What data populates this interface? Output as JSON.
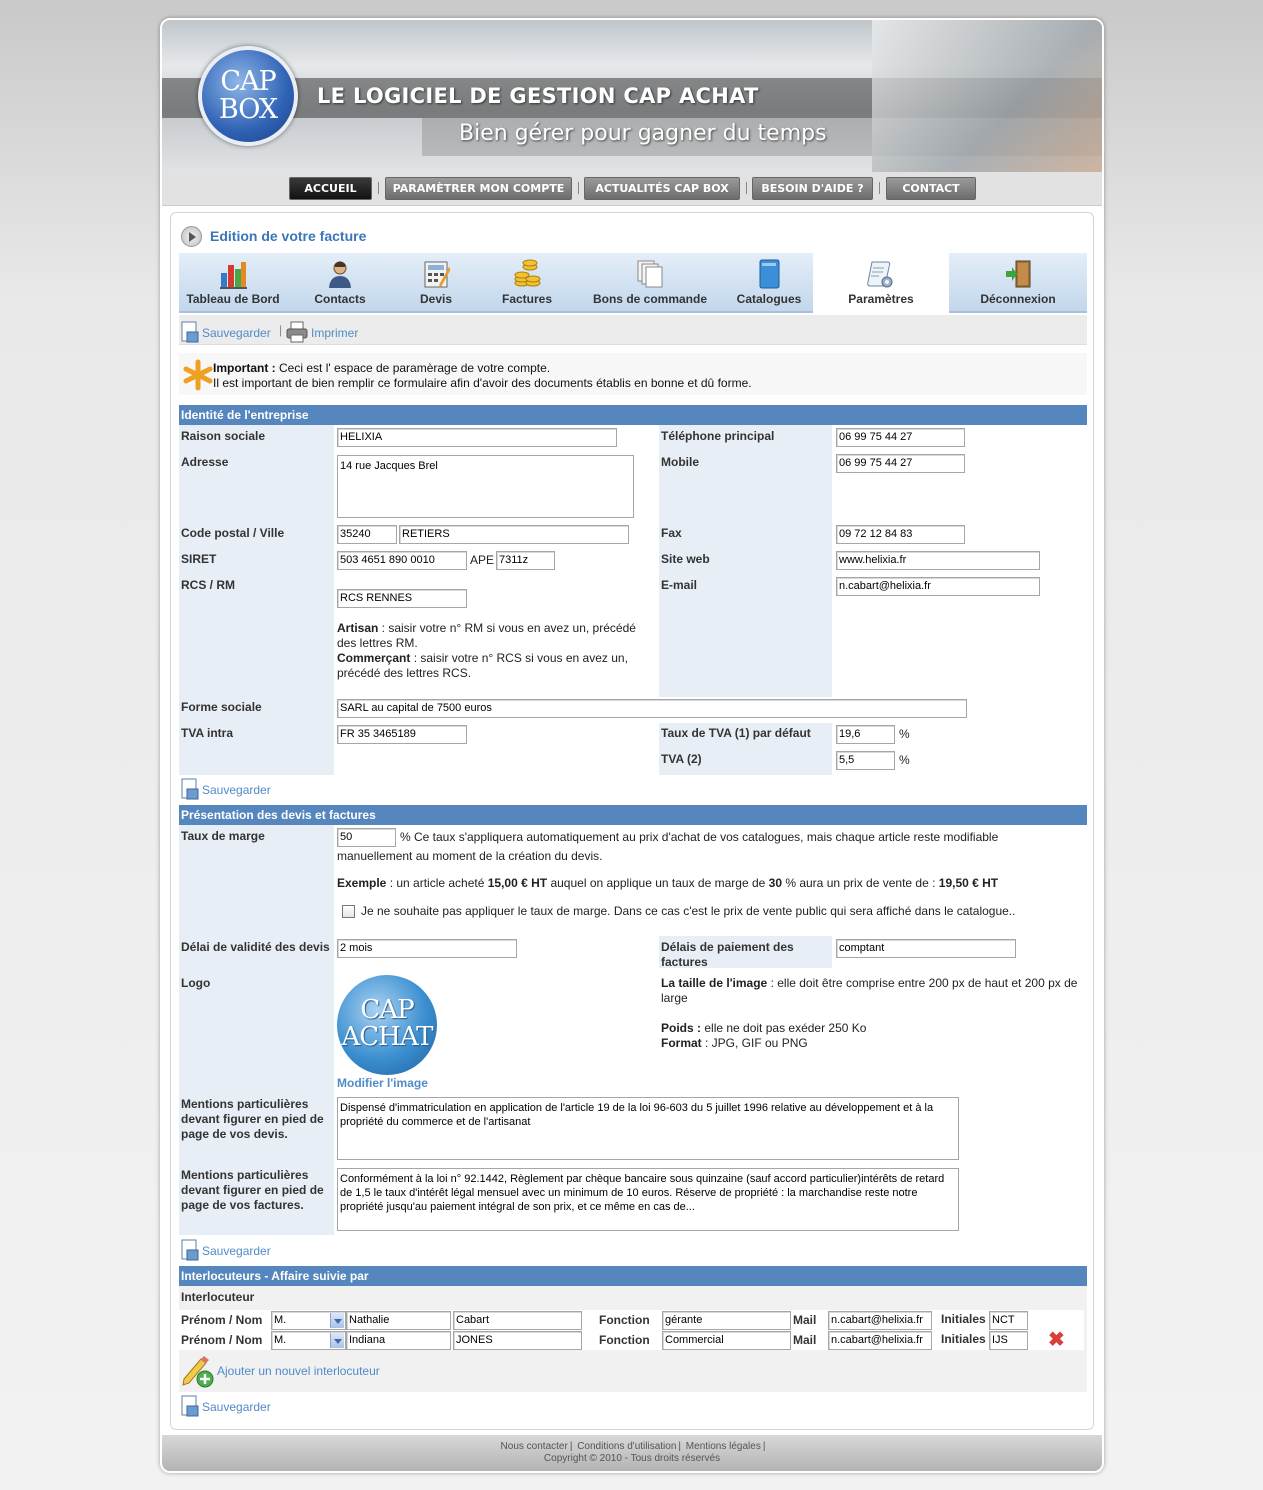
{
  "header": {
    "logo_line1": "CAP",
    "logo_line2": "BOX",
    "title": "LE LOGICIEL DE GESTION CAP ACHAT",
    "subtitle": "Bien gérer pour gagner du temps"
  },
  "nav": {
    "items": [
      {
        "label": "ACCUEIL"
      },
      {
        "label": "PARAMÈTRER MON COMPTE"
      },
      {
        "label": "ACTUALITÉS CAP BOX"
      },
      {
        "label": "BESOIN D'AIDE ?"
      },
      {
        "label": "CONTACT"
      }
    ]
  },
  "page": {
    "title": "Edition de votre facture"
  },
  "tabs": [
    {
      "label": "Tableau de Bord",
      "icon": "bar-chart-icon"
    },
    {
      "label": "Contacts",
      "icon": "user-icon"
    },
    {
      "label": "Devis",
      "icon": "calculator-icon"
    },
    {
      "label": "Factures",
      "icon": "coins-icon"
    },
    {
      "label": "Bons de commande",
      "icon": "documents-icon"
    },
    {
      "label": "Catalogues",
      "icon": "book-icon"
    },
    {
      "label": "Paramètres",
      "icon": "settings-scroll-icon"
    },
    {
      "label": "Déconnexion",
      "icon": "exit-door-icon"
    }
  ],
  "toolbar": {
    "save": "Sauvegarder",
    "print": "Imprimer"
  },
  "notice": {
    "bold": "Important :",
    "line1": " Ceci est l' espace de paramèrage de votre compte.",
    "line2": "Il est important de bien remplir ce formulaire afin d'avoir des documents établis en bonne et dû forme."
  },
  "identity": {
    "heading": "Identité de l'entreprise",
    "raison_label": "Raison sociale",
    "raison": "HELIXIA",
    "adresse_label": "Adresse",
    "adresse": "14 rue Jacques Brel",
    "cp_label": "Code postal / Ville",
    "cp": "35240",
    "ville": "RETIERS",
    "siret_label": "SIRET",
    "siret": "503 4651 890 0010",
    "ape_label": "APE",
    "ape": "7311z",
    "rcs_label": "RCS / RM",
    "rcs": "RCS RENNES",
    "artisan_bold": "Artisan",
    "artisan_text1": " : saisir votre n° RM si vous en avez un, précédé",
    "artisan_text2": "des lettres RM.",
    "commercant_bold": "Commerçant",
    "commercant_text1": " : saisir votre n° RCS si vous en avez un,",
    "commercant_text2": "précédé des lettres RCS.",
    "forme_label": "Forme sociale",
    "forme": "SARL au capital de 7500 euros",
    "tva_label": "TVA intra",
    "tva": "FR 35 3465189",
    "tel_label": "Téléphone principal",
    "tel": "06 99 75 44 27",
    "mobile_label": "Mobile",
    "mobile": "06 99 75 44 27",
    "fax_label": "Fax",
    "fax": "09 72 12 84 83",
    "web_label": "Site web",
    "web": "www.helixia.fr",
    "email_label": "E-mail",
    "email": "n.cabart@helixia.fr",
    "taux1_label": "Taux de TVA (1) par défaut",
    "taux1": "19,6",
    "tva2_label": "TVA (2)",
    "tva2": "5,5",
    "percent": "%"
  },
  "save_label": "Sauvegarder",
  "presentation": {
    "heading": "Présentation des devis et factures",
    "marge_label": "Taux de marge",
    "marge": "50",
    "marge_text1": "% Ce taux s'appliquera automatiquement au prix d'achat de vos catalogues, mais chaque article reste modifiable",
    "marge_text2": "manuellement au moment de la création du devis.",
    "ex_bold": "Exemple",
    "ex_t1": " : un article acheté ",
    "ex_b2": "15,00 € HT",
    "ex_t2": " auquel on applique un taux de marge de ",
    "ex_b3": "30",
    "ex_t3": " % aura un prix de vente de : ",
    "ex_b4": "19,50 € HT",
    "checkbox_text": "Je ne souhaite pas appliquer le taux de marge. Dans ce cas c'est le prix de vente public qui sera affiché dans le catalogue..",
    "validite_label": "Délai de validité des devis",
    "validite": "2 mois",
    "paiement_label1": "Délais de paiement des",
    "paiement_label2": "factures",
    "paiement": "comptant",
    "logo_label": "Logo",
    "logo_l1": "CAP",
    "logo_l2": "ACHAT",
    "modifier": "Modifier l'image",
    "taille_bold": "La taille de l'image",
    "taille_text1": " : elle doit être comprise entre 200 px de haut et 200 px de",
    "taille_text2": "large",
    "poids_bold": "Poids :",
    "poids_text": " elle ne doit pas exéder 250 Ko",
    "format_bold": "Format",
    "format_text": " : JPG, GIF ou PNG",
    "mentions_devis_l1": "Mentions particulières",
    "mentions_devis_l2": "devant figurer en pied de",
    "mentions_devis_l3": "page de vos devis.",
    "mentions_devis": "Dispensé d'immatriculation en application de l'article 19 de la loi 96-603 du 5 juillet 1996 relative au développement et à la propriété du commerce et de l'artisanat",
    "mentions_fact_l1": "Mentions particulières",
    "mentions_fact_l2": "devant figurer en pied de",
    "mentions_fact_l3": "page de vos factures.",
    "mentions_fact": "Conformément à la loi n° 92.1442, Règlement par chèque bancaire sous quinzaine (sauf accord particulier)intérêts de retard de 1,5 le taux d'intérêt légal mensuel avec un minimum de 10 euros. Réserve de propriété : la marchandise reste notre propriété jusqu'au paiement intégral de son prix, et ce même en cas de..."
  },
  "interlocuteurs": {
    "heading": "Interlocuteurs - Affaire suivie par",
    "subheading": "Interlocuteur",
    "prenom_label": "Prénom / Nom",
    "fonction_label": "Fonction",
    "mail_label": "Mail",
    "initiales_label": "Initiales",
    "rows": [
      {
        "civ": "M.",
        "prenom": "Nathalie",
        "nom": "Cabart",
        "fonction": "gérante",
        "mail": "n.cabart@helixia.fr",
        "initiales": "NCT"
      },
      {
        "civ": "M.",
        "prenom": "Indiana",
        "nom": "JONES",
        "fonction": "Commercial",
        "mail": "n.cabart@helixia.fr",
        "initiales": "IJS"
      }
    ],
    "add": "Ajouter un nouvel interlocuteur"
  },
  "footer": {
    "links": [
      "Nous contacter",
      "Conditions d'utilisation",
      "Mentions légales"
    ],
    "copyright": "Copyright © 2010 - Tous droits réservés"
  }
}
